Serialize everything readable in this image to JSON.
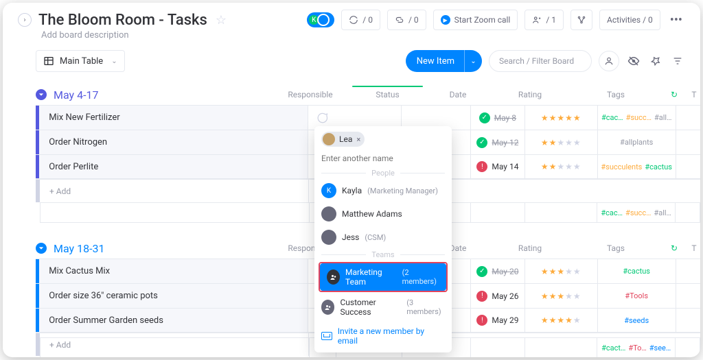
{
  "header": {
    "title": "The Bloom Room - Tasks",
    "subtitle": "Add board description",
    "avatar_initial": "K",
    "automations": "/ 0",
    "integrations": "/ 0",
    "zoom": "Start Zoom call",
    "guests": "/ 1",
    "activities": "Activities / 0"
  },
  "toolbar": {
    "view": "Main Table",
    "new_item": "New Item",
    "search_placeholder": "Search / Filter Board"
  },
  "columns": {
    "responsible": "Responsible",
    "status": "Status",
    "date": "Date",
    "rating": "Rating",
    "tags": "Tags",
    "extraT": "T"
  },
  "groups": [
    {
      "title": "May 4-17",
      "color": "purple",
      "rows": [
        {
          "name": "Mix New Fertilizer",
          "status": "done",
          "date": "May 8",
          "date_strike": true,
          "rating": 5,
          "tags": [
            "#cac…",
            "#succ…",
            "#all…"
          ],
          "tag_classes": [
            "tag-cactus",
            "tag-succ",
            "tag-all"
          ]
        },
        {
          "name": "Order Nitrogen",
          "status": "done",
          "date": "May 12",
          "date_strike": true,
          "rating": 2,
          "tags": [
            "#allplants"
          ],
          "tag_classes": [
            "tag-all"
          ]
        },
        {
          "name": "Order Perlite",
          "status": "alert",
          "date": "May 14",
          "date_strike": false,
          "rating": 2,
          "tags": [
            "#succulents",
            "#cactus"
          ],
          "tag_classes": [
            "tag-succ",
            "tag-cactus"
          ]
        }
      ],
      "footer_tags": [
        "#cac…",
        "#succ…",
        "#all…"
      ],
      "footer_tag_classes": [
        "tag-cactus",
        "tag-succ",
        "tag-all"
      ]
    },
    {
      "title": "May 18-31",
      "color": "blue",
      "rows": [
        {
          "name": "Mix Cactus Mix",
          "status": "done",
          "date": "May 20",
          "date_strike": true,
          "rating": 3,
          "tags": [
            "#cactus"
          ],
          "tag_classes": [
            "tag-cactus"
          ]
        },
        {
          "name": "Order size 36\" ceramic pots",
          "status": "alert",
          "date": "May 26",
          "date_strike": false,
          "rating": 3,
          "tags": [
            "#Tools"
          ],
          "tag_classes": [
            "tag-tools"
          ]
        },
        {
          "name": "Order Summer Garden seeds",
          "status": "alert",
          "date": "May 29",
          "date_strike": false,
          "rating": 4,
          "tags": [
            "#seeds"
          ],
          "tag_classes": [
            "tag-seeds"
          ]
        }
      ],
      "footer_tags": [
        "#cact…",
        "#To…",
        "#see…"
      ],
      "footer_tag_classes": [
        "tag-cactus",
        "tag-tools",
        "tag-seeds"
      ]
    }
  ],
  "add_row": "+ Add",
  "dropdown": {
    "chip": "Lea",
    "placeholder": "Enter another name",
    "sep_people": "People",
    "sep_teams": "Teams",
    "people": [
      {
        "name": "Kayla",
        "sub": "(Marketing Manager)",
        "av": "K",
        "avclass": "k"
      },
      {
        "name": "Matthew Adams",
        "sub": "",
        "av": "",
        "avclass": ""
      },
      {
        "name": "Jess",
        "sub": "(CSM)",
        "av": "",
        "avclass": ""
      }
    ],
    "team": {
      "name": "Marketing Team",
      "sub": "(2 members)"
    },
    "team2": {
      "name": "Customer Success",
      "sub": "(3 members)"
    },
    "invite": "Invite a new member by email"
  }
}
